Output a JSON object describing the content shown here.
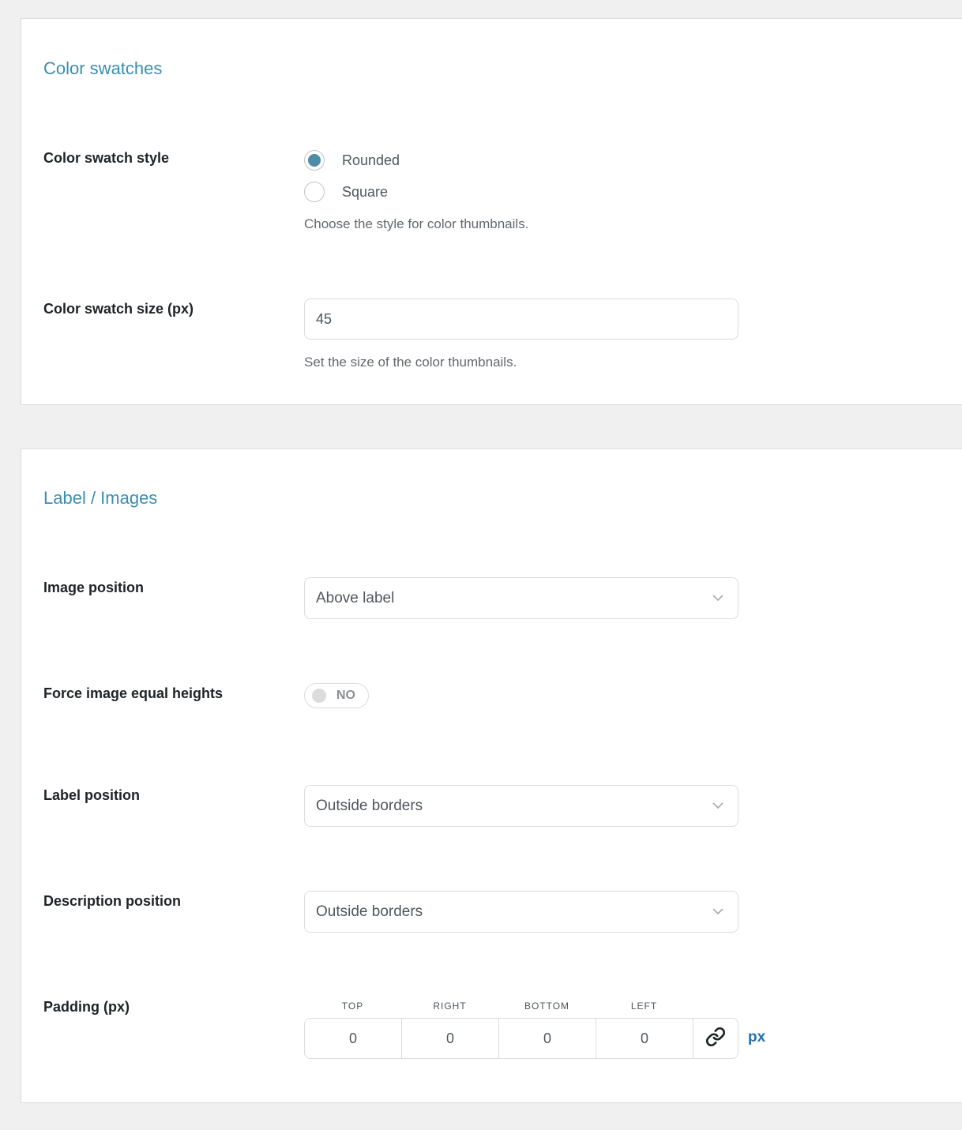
{
  "sections": {
    "color_swatches": {
      "title": "Color swatches",
      "swatch_style": {
        "label": "Color swatch style",
        "options": [
          {
            "label": "Rounded",
            "selected": true
          },
          {
            "label": "Square",
            "selected": false
          }
        ],
        "help": "Choose the style for color thumbnails."
      },
      "swatch_size": {
        "label": "Color swatch size (px)",
        "value": "45",
        "help": "Set the size of the color thumbnails."
      }
    },
    "label_images": {
      "title": "Label / Images",
      "image_position": {
        "label": "Image position",
        "value": "Above label"
      },
      "equal_heights": {
        "label": "Force image equal heights",
        "state": "NO"
      },
      "label_position": {
        "label": "Label position",
        "value": "Outside borders"
      },
      "description_position": {
        "label": "Description position",
        "value": "Outside borders"
      },
      "padding": {
        "label": "Padding (px)",
        "headers": {
          "top": "TOP",
          "right": "RIGHT",
          "bottom": "BOTTOM",
          "left": "LEFT"
        },
        "values": {
          "top": "0",
          "right": "0",
          "bottom": "0",
          "left": "0"
        },
        "unit": "px",
        "link_icon": "link-icon"
      }
    }
  },
  "colors": {
    "accent": "#3a8eb0",
    "radio_selected": "#4e8ba6",
    "unit": "#2271b1",
    "background": "#f0f0f1"
  }
}
